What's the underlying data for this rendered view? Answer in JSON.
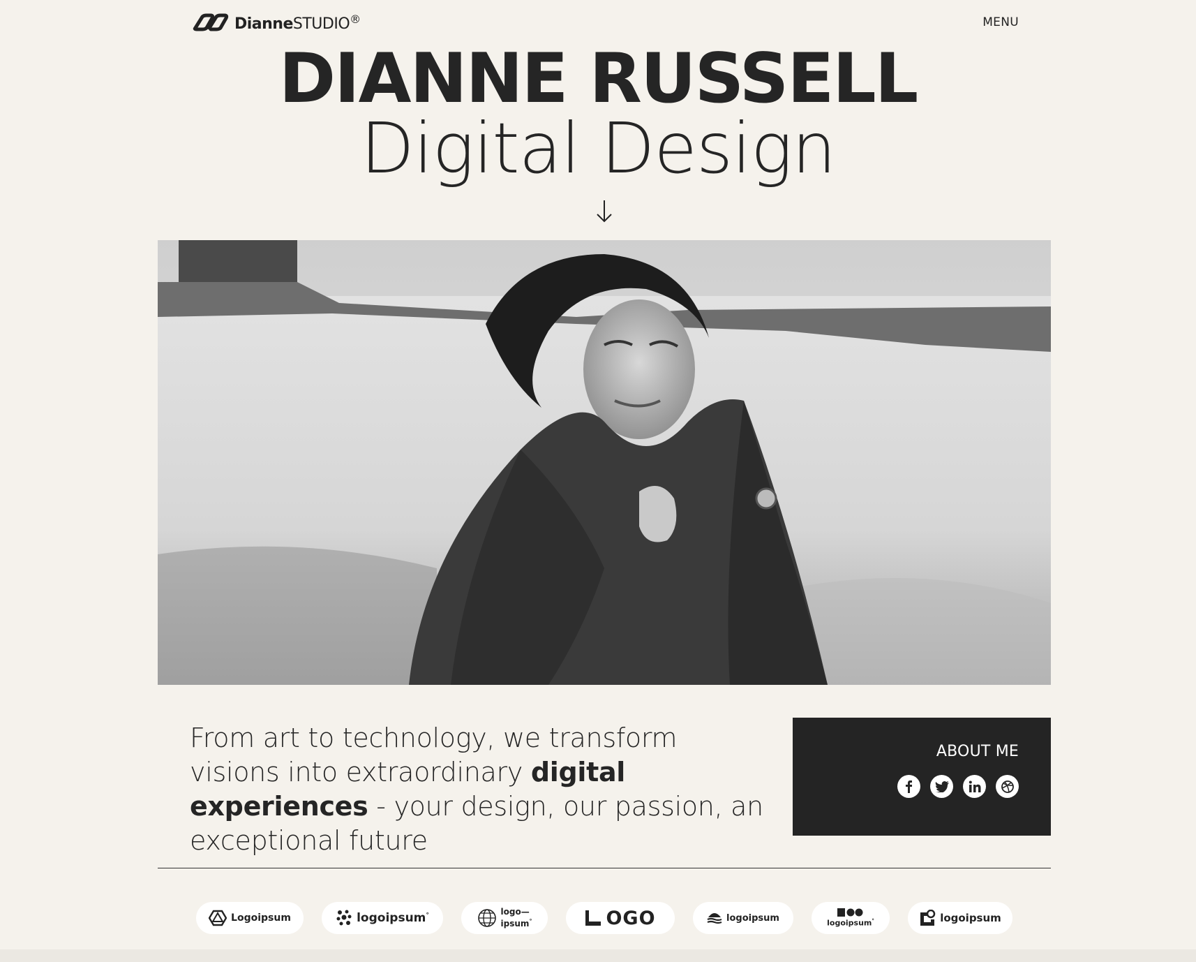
{
  "header": {
    "brand_bold": "Dianne",
    "brand_light": "STUDIO",
    "brand_mark": "®",
    "menu_label": "MENU"
  },
  "hero": {
    "title": "DIANNE RUSSELL",
    "subtitle": "Digital Design",
    "arrow_icon": "arrow-down-icon"
  },
  "intro": {
    "text_before": "From art to technology, we transform visions into extraordinary ",
    "text_bold": "digital experiences",
    "text_after": " - your design, our passion, an exceptional future"
  },
  "about": {
    "title": "ABOUT ME",
    "socials": [
      "facebook-icon",
      "twitter-icon",
      "linkedin-icon",
      "dribbble-icon"
    ]
  },
  "partners": [
    {
      "text": "Logoipsum",
      "icon": "hexagon-logo"
    },
    {
      "text": "logoipsum",
      "mark": "°",
      "icon": "wave-logo"
    },
    {
      "text_line1": "logo—",
      "text_line2": "ipsum",
      "mark": "°",
      "icon": "globe-logo"
    },
    {
      "text": "OGO",
      "icon": "square-logo"
    },
    {
      "text": "logoipsum",
      "icon": "stack-logo"
    },
    {
      "text": "logoipsum",
      "mark": "°",
      "icon": "blocks-logo"
    },
    {
      "text": "logoipsum",
      "icon": "pin-logo"
    }
  ],
  "colors": {
    "background": "#f5f2ec",
    "dark": "#242424",
    "text": "#252525",
    "pill": "#ffffff"
  }
}
